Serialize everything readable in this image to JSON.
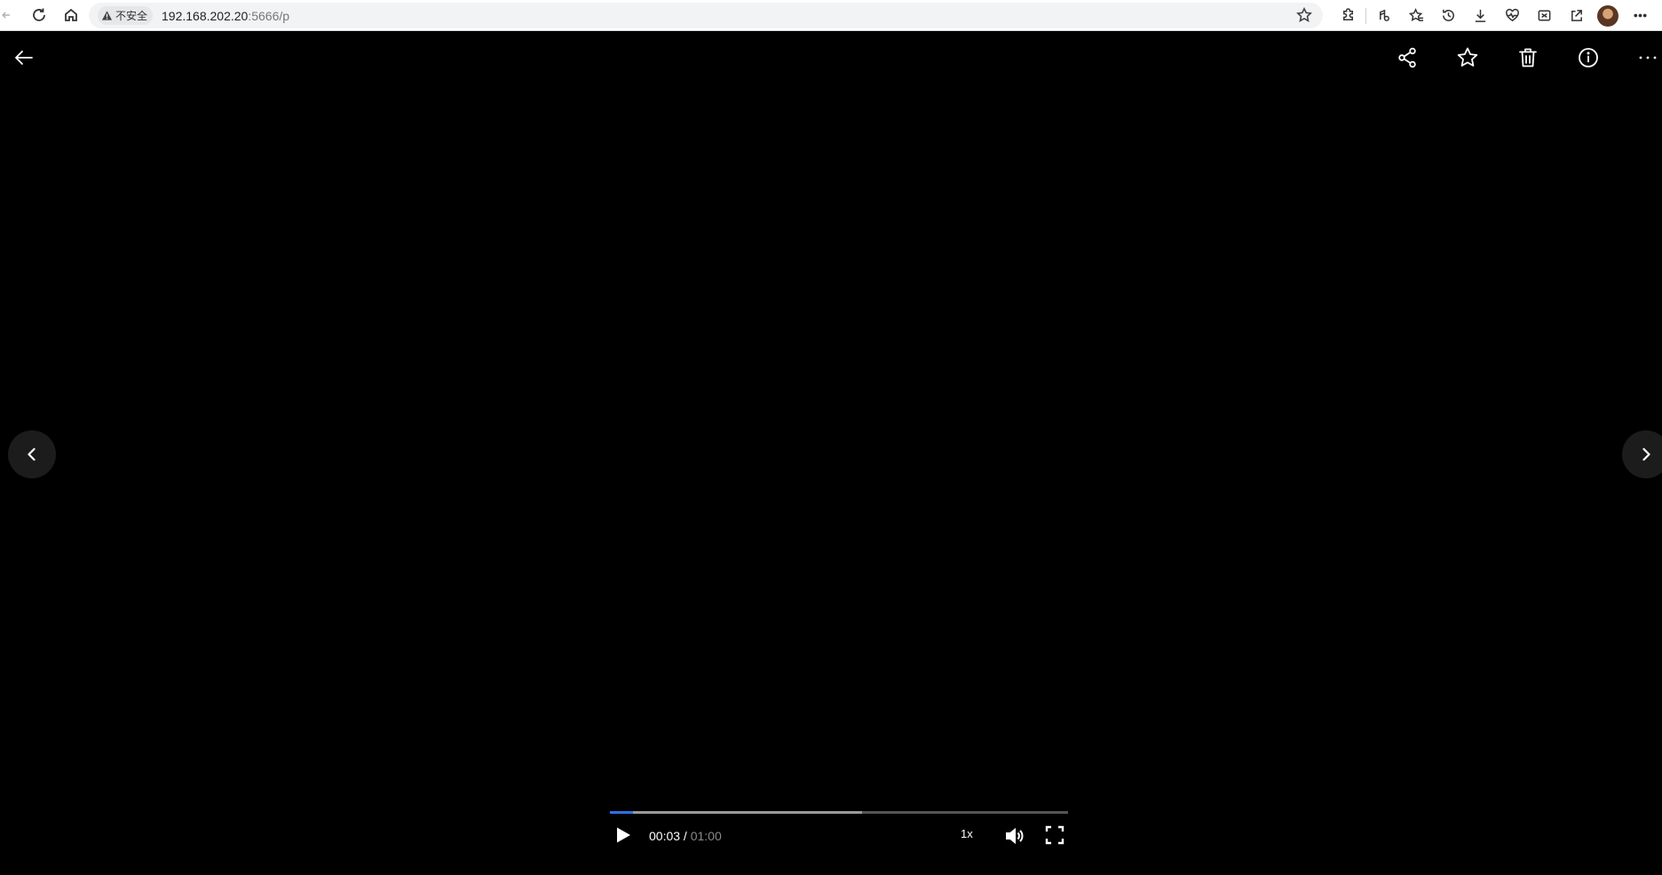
{
  "browser": {
    "security_label": "不安全",
    "url_host": "192.168.202.20",
    "url_rest": ":5666/p"
  },
  "player": {
    "current_time": "00:03",
    "separator": " / ",
    "total_time": "01:00",
    "speed": "1x",
    "played_fraction": 0.05,
    "buffered_fraction": 0.55,
    "colors": {
      "played": "#2f6fe4",
      "buffered": "#9a9a9a",
      "track": "#555555"
    }
  },
  "icons": {
    "back": "arrow-left-icon",
    "share": "share-icon",
    "favorite": "star-icon",
    "delete": "trash-icon",
    "info": "info-icon",
    "more": "more-icon",
    "prev": "chevron-left-icon",
    "next": "chevron-right-icon",
    "play": "play-icon",
    "volume": "volume-icon",
    "fullscreen": "fullscreen-icon"
  }
}
